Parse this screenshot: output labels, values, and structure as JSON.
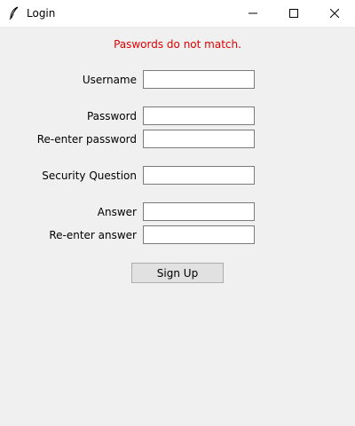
{
  "window": {
    "title": "Login",
    "icon": "feather-icon",
    "controls": {
      "minimize_icon": "minimize-icon",
      "maximize_icon": "maximize-icon",
      "close_icon": "close-icon"
    }
  },
  "form": {
    "error_message": "Paswords do not match.",
    "error_color": "#e00000",
    "fields": {
      "username": {
        "label": "Username",
        "value": ""
      },
      "password": {
        "label": "Password",
        "value": ""
      },
      "reenter_password": {
        "label": "Re-enter password",
        "value": ""
      },
      "security_question": {
        "label": "Security Question",
        "value": ""
      },
      "answer": {
        "label": "Answer",
        "value": ""
      },
      "reenter_answer": {
        "label": "Re-enter answer",
        "value": ""
      }
    },
    "submit_label": "Sign Up"
  }
}
